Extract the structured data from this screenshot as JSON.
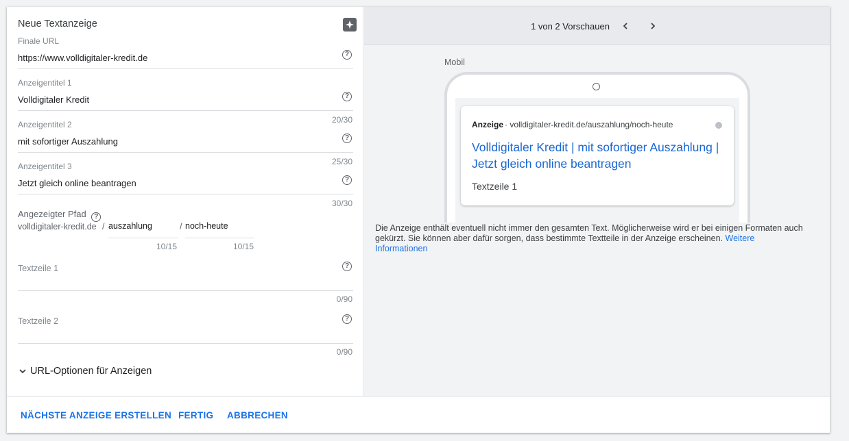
{
  "form": {
    "title": "Neue Textanzeige",
    "final_url": {
      "label": "Finale URL",
      "value": "https://www.volldigitaler-kredit.de"
    },
    "headline1": {
      "label": "Anzeigentitel 1",
      "value": "Volldigitaler Kredit",
      "counter": "20/30"
    },
    "headline2": {
      "label": "Anzeigentitel 2",
      "value": "mit sofortiger Auszahlung",
      "counter": "25/30"
    },
    "headline3": {
      "label": "Anzeigentitel 3",
      "value": "Jetzt gleich online beantragen",
      "counter": "30/30"
    },
    "path": {
      "label": "Angezeigter Pfad",
      "domain": "volldigitaler-kredit.de",
      "sep": "/",
      "path1": "auszahlung",
      "path1_counter": "10/15",
      "path2": "noch-heute",
      "path2_counter": "10/15"
    },
    "desc1": {
      "label": "Textzeile 1",
      "value": "",
      "counter": "0/90"
    },
    "desc2": {
      "label": "Textzeile 2",
      "value": "",
      "counter": "0/90"
    },
    "url_options": "URL-Optionen für Anzeigen",
    "help_glyph": "?"
  },
  "footer": {
    "next": "NÄCHSTE ANZEIGE ERSTELLEN",
    "done": "FERTIG",
    "cancel": "ABBRECHEN"
  },
  "preview": {
    "count": "1 von 2 Vorschauen",
    "device": "Mobil",
    "ad_tag": "Anzeige",
    "ad_url": "· volldigitaler-kredit.de/auszahlung/noch-heute",
    "headline": "Volldigitaler Kredit | mit sofortiger Auszahlung | Jetzt gleich online beantragen",
    "description": "Textzeile 1",
    "disclaimer": "Die Anzeige enthält eventuell nicht immer den gesamten Text. Möglicherweise wird er bei einigen Formaten auch gekürzt. Sie können aber dafür sorgen, dass bestimmte Textteile in der Anzeige erscheinen.",
    "more_link": "Weitere Informationen"
  },
  "colors": {
    "accent": "#1a73e8",
    "ad_headline": "#1967d2"
  }
}
